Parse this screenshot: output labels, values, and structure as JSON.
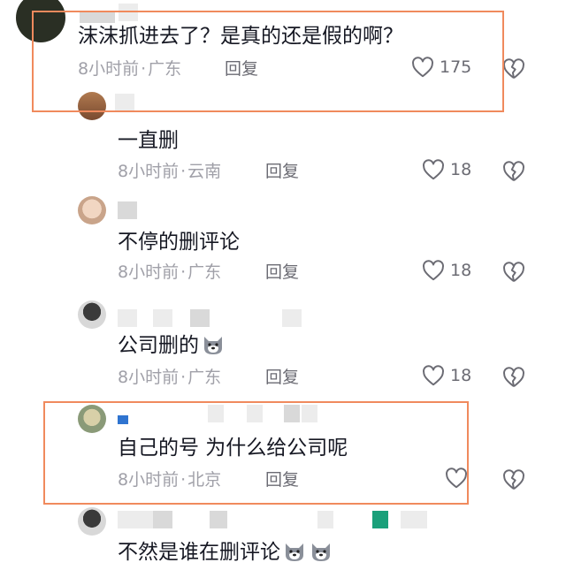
{
  "comments": [
    {
      "text": "沫沫抓进去了？是真的还是假的啊？",
      "time": "8小时前",
      "sep": "·",
      "location": "广东",
      "reply_label": "回复",
      "likes": "175",
      "avatar_color": "#2f3a22"
    },
    {
      "text": "一直删",
      "time": "8小时前",
      "sep": "·",
      "location": "云南",
      "reply_label": "回复",
      "likes": "18",
      "avatar_color": "#8b5a3c"
    },
    {
      "text": "不停的删评论",
      "time": "8小时前",
      "sep": "·",
      "location": "广东",
      "reply_label": "回复",
      "likes": "18",
      "avatar_color": "#e8c8b0"
    },
    {
      "text": "公司删的",
      "time": "8小时前",
      "sep": "·",
      "location": "广东",
      "reply_label": "回复",
      "likes": "18",
      "avatar_color": "#1a1a1a"
    },
    {
      "text": "自己的号  为什么给公司呢",
      "time": "8小时前",
      "sep": "·",
      "location": "北京",
      "reply_label": "回复",
      "likes": "",
      "avatar_color": "#9aa88a"
    },
    {
      "text": "不然是谁在删评论",
      "avatar_color": "#1a1a1a"
    }
  ],
  "colors": {
    "highlight": "#f08a5d",
    "meta": "#a0a0a8",
    "text": "#161823"
  },
  "icons": [
    "heart-outline-icon",
    "broken-heart-icon",
    "dog-face-emoji"
  ]
}
